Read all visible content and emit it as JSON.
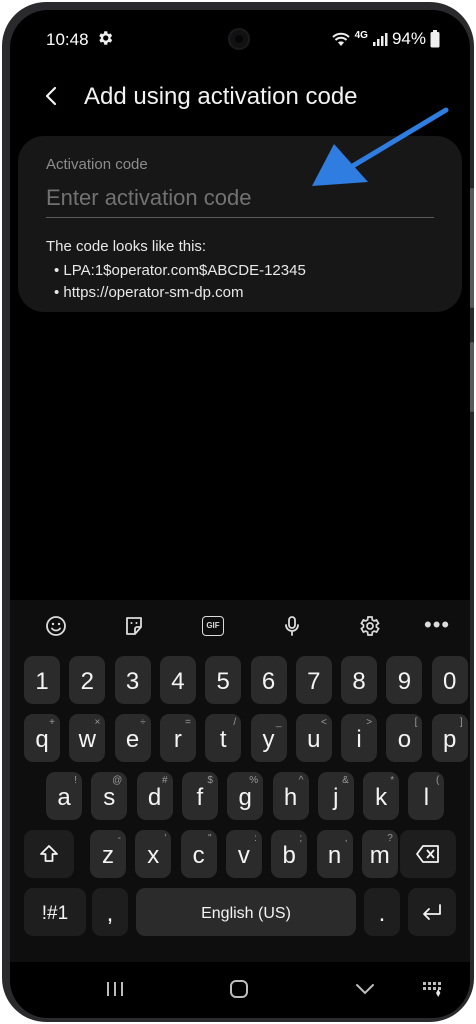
{
  "status_bar": {
    "time": "10:48",
    "network": "4G",
    "battery": "94%"
  },
  "header": {
    "title": "Add using activation code"
  },
  "form": {
    "label": "Activation code",
    "placeholder": "Enter activation code",
    "value": "",
    "hint_title": "The code looks like this:",
    "hint_examples": [
      "LPA:1$operator.com$ABCDE-12345",
      "https://operator-sm-dp.com"
    ]
  },
  "annotation": {
    "arrow_color": "#2f7de1"
  },
  "keyboard": {
    "toolbar_icons": [
      "emoji-icon",
      "sticker-icon",
      "gif-icon",
      "microphone-icon",
      "settings-icon",
      "more-icon"
    ],
    "gif_label": "GIF",
    "more_label": "•••",
    "number_row": [
      "1",
      "2",
      "3",
      "4",
      "5",
      "6",
      "7",
      "8",
      "9",
      "0"
    ],
    "row1": [
      {
        "key": "q",
        "sub": "+"
      },
      {
        "key": "w",
        "sub": "×"
      },
      {
        "key": "e",
        "sub": "÷"
      },
      {
        "key": "r",
        "sub": "="
      },
      {
        "key": "t",
        "sub": "/"
      },
      {
        "key": "y",
        "sub": "_"
      },
      {
        "key": "u",
        "sub": "<"
      },
      {
        "key": "i",
        "sub": ">"
      },
      {
        "key": "o",
        "sub": "["
      },
      {
        "key": "p",
        "sub": "]"
      }
    ],
    "row2": [
      {
        "key": "a",
        "sub": "!"
      },
      {
        "key": "s",
        "sub": "@"
      },
      {
        "key": "d",
        "sub": "#"
      },
      {
        "key": "f",
        "sub": "$"
      },
      {
        "key": "g",
        "sub": "%"
      },
      {
        "key": "h",
        "sub": "^"
      },
      {
        "key": "j",
        "sub": "&"
      },
      {
        "key": "k",
        "sub": "*"
      },
      {
        "key": "l",
        "sub": "("
      }
    ],
    "row3": [
      {
        "key": "z",
        "sub": "-"
      },
      {
        "key": "x",
        "sub": "'"
      },
      {
        "key": "c",
        "sub": "\""
      },
      {
        "key": "v",
        "sub": ":"
      },
      {
        "key": "b",
        "sub": ";"
      },
      {
        "key": "n",
        "sub": ","
      },
      {
        "key": "m",
        "sub": "?"
      }
    ],
    "symbols_key": "!#1",
    "comma_key": ",",
    "space_label": "English (US)",
    "period_key": "."
  }
}
